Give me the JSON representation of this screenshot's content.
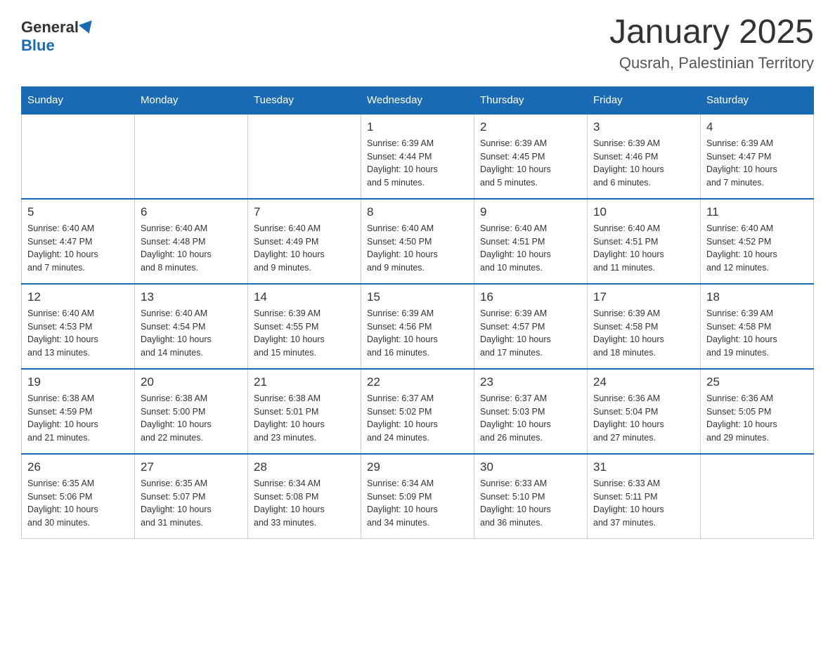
{
  "logo": {
    "general": "General",
    "blue": "Blue"
  },
  "title": "January 2025",
  "subtitle": "Qusrah, Palestinian Territory",
  "days_header": [
    "Sunday",
    "Monday",
    "Tuesday",
    "Wednesday",
    "Thursday",
    "Friday",
    "Saturday"
  ],
  "weeks": [
    [
      {
        "day": "",
        "info": ""
      },
      {
        "day": "",
        "info": ""
      },
      {
        "day": "",
        "info": ""
      },
      {
        "day": "1",
        "info": "Sunrise: 6:39 AM\nSunset: 4:44 PM\nDaylight: 10 hours\nand 5 minutes."
      },
      {
        "day": "2",
        "info": "Sunrise: 6:39 AM\nSunset: 4:45 PM\nDaylight: 10 hours\nand 5 minutes."
      },
      {
        "day": "3",
        "info": "Sunrise: 6:39 AM\nSunset: 4:46 PM\nDaylight: 10 hours\nand 6 minutes."
      },
      {
        "day": "4",
        "info": "Sunrise: 6:39 AM\nSunset: 4:47 PM\nDaylight: 10 hours\nand 7 minutes."
      }
    ],
    [
      {
        "day": "5",
        "info": "Sunrise: 6:40 AM\nSunset: 4:47 PM\nDaylight: 10 hours\nand 7 minutes."
      },
      {
        "day": "6",
        "info": "Sunrise: 6:40 AM\nSunset: 4:48 PM\nDaylight: 10 hours\nand 8 minutes."
      },
      {
        "day": "7",
        "info": "Sunrise: 6:40 AM\nSunset: 4:49 PM\nDaylight: 10 hours\nand 9 minutes."
      },
      {
        "day": "8",
        "info": "Sunrise: 6:40 AM\nSunset: 4:50 PM\nDaylight: 10 hours\nand 9 minutes."
      },
      {
        "day": "9",
        "info": "Sunrise: 6:40 AM\nSunset: 4:51 PM\nDaylight: 10 hours\nand 10 minutes."
      },
      {
        "day": "10",
        "info": "Sunrise: 6:40 AM\nSunset: 4:51 PM\nDaylight: 10 hours\nand 11 minutes."
      },
      {
        "day": "11",
        "info": "Sunrise: 6:40 AM\nSunset: 4:52 PM\nDaylight: 10 hours\nand 12 minutes."
      }
    ],
    [
      {
        "day": "12",
        "info": "Sunrise: 6:40 AM\nSunset: 4:53 PM\nDaylight: 10 hours\nand 13 minutes."
      },
      {
        "day": "13",
        "info": "Sunrise: 6:40 AM\nSunset: 4:54 PM\nDaylight: 10 hours\nand 14 minutes."
      },
      {
        "day": "14",
        "info": "Sunrise: 6:39 AM\nSunset: 4:55 PM\nDaylight: 10 hours\nand 15 minutes."
      },
      {
        "day": "15",
        "info": "Sunrise: 6:39 AM\nSunset: 4:56 PM\nDaylight: 10 hours\nand 16 minutes."
      },
      {
        "day": "16",
        "info": "Sunrise: 6:39 AM\nSunset: 4:57 PM\nDaylight: 10 hours\nand 17 minutes."
      },
      {
        "day": "17",
        "info": "Sunrise: 6:39 AM\nSunset: 4:58 PM\nDaylight: 10 hours\nand 18 minutes."
      },
      {
        "day": "18",
        "info": "Sunrise: 6:39 AM\nSunset: 4:58 PM\nDaylight: 10 hours\nand 19 minutes."
      }
    ],
    [
      {
        "day": "19",
        "info": "Sunrise: 6:38 AM\nSunset: 4:59 PM\nDaylight: 10 hours\nand 21 minutes."
      },
      {
        "day": "20",
        "info": "Sunrise: 6:38 AM\nSunset: 5:00 PM\nDaylight: 10 hours\nand 22 minutes."
      },
      {
        "day": "21",
        "info": "Sunrise: 6:38 AM\nSunset: 5:01 PM\nDaylight: 10 hours\nand 23 minutes."
      },
      {
        "day": "22",
        "info": "Sunrise: 6:37 AM\nSunset: 5:02 PM\nDaylight: 10 hours\nand 24 minutes."
      },
      {
        "day": "23",
        "info": "Sunrise: 6:37 AM\nSunset: 5:03 PM\nDaylight: 10 hours\nand 26 minutes."
      },
      {
        "day": "24",
        "info": "Sunrise: 6:36 AM\nSunset: 5:04 PM\nDaylight: 10 hours\nand 27 minutes."
      },
      {
        "day": "25",
        "info": "Sunrise: 6:36 AM\nSunset: 5:05 PM\nDaylight: 10 hours\nand 29 minutes."
      }
    ],
    [
      {
        "day": "26",
        "info": "Sunrise: 6:35 AM\nSunset: 5:06 PM\nDaylight: 10 hours\nand 30 minutes."
      },
      {
        "day": "27",
        "info": "Sunrise: 6:35 AM\nSunset: 5:07 PM\nDaylight: 10 hours\nand 31 minutes."
      },
      {
        "day": "28",
        "info": "Sunrise: 6:34 AM\nSunset: 5:08 PM\nDaylight: 10 hours\nand 33 minutes."
      },
      {
        "day": "29",
        "info": "Sunrise: 6:34 AM\nSunset: 5:09 PM\nDaylight: 10 hours\nand 34 minutes."
      },
      {
        "day": "30",
        "info": "Sunrise: 6:33 AM\nSunset: 5:10 PM\nDaylight: 10 hours\nand 36 minutes."
      },
      {
        "day": "31",
        "info": "Sunrise: 6:33 AM\nSunset: 5:11 PM\nDaylight: 10 hours\nand 37 minutes."
      },
      {
        "day": "",
        "info": ""
      }
    ]
  ]
}
